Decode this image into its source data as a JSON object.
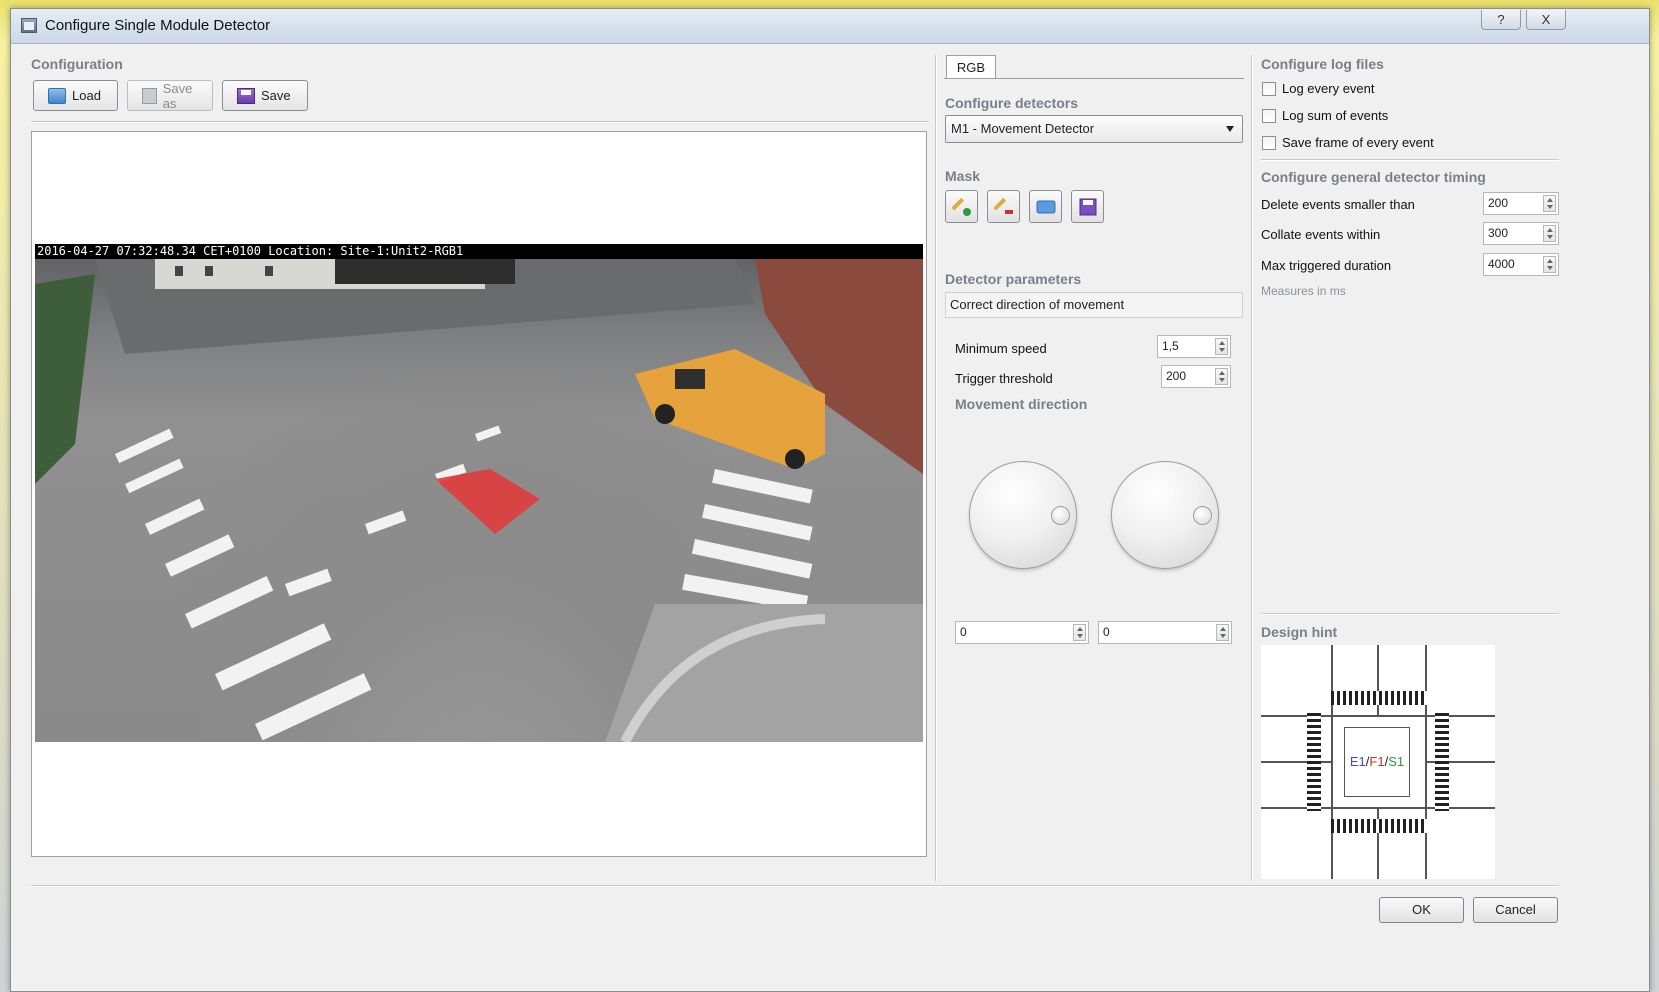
{
  "window": {
    "title": "Configure Single Module Detector",
    "help_label": "?",
    "close_label": "X"
  },
  "configuration": {
    "section_label": "Configuration",
    "load_label": "Load",
    "save_as_label": "Save as",
    "save_label": "Save"
  },
  "camera": {
    "overlay_text": "2016-04-27 07:32:48.34 CET+0100 Location: Site-1:Unit2-RGB1"
  },
  "detectors": {
    "tab_label": "RGB",
    "section_label": "Configure detectors",
    "selected_detector": "M1 - Movement Detector",
    "mask_label": "Mask",
    "mask_buttons": [
      "add-mask-icon",
      "erase-mask-icon",
      "open-mask-icon",
      "save-mask-icon"
    ],
    "params_label": "Detector parameters",
    "params_header": "Correct direction of movement",
    "min_speed_label": "Minimum speed",
    "min_speed_value": "1,5",
    "trigger_label": "Trigger threshold",
    "trigger_value": "200",
    "movement_dir_label": "Movement direction",
    "dir1_value": "0",
    "dir2_value": "0"
  },
  "logfiles": {
    "section_label": "Configure log files",
    "log_every_label": "Log every event",
    "log_sum_label": "Log sum of events",
    "save_frame_label": "Save frame of every event"
  },
  "timing": {
    "section_label": "Configure general detector timing",
    "delete_label": "Delete events smaller than",
    "delete_value": "200",
    "collate_label": "Collate events within",
    "collate_value": "300",
    "max_label": "Max triggered duration",
    "max_value": "4000",
    "units_note": "Measures in ms"
  },
  "design_hint": {
    "label": "Design hint",
    "center_e": "E1",
    "center_f": "F1",
    "center_s": "S1",
    "slash": "/",
    "colors": {
      "e": "#3b4fbf",
      "f": "#c0392b",
      "s": "#2e9a3e"
    }
  },
  "footer": {
    "ok_label": "OK",
    "cancel_label": "Cancel"
  },
  "colors": {
    "section_label": "#7b7f85",
    "mask_area": "#e03c3c",
    "van": "#e6a23c"
  }
}
